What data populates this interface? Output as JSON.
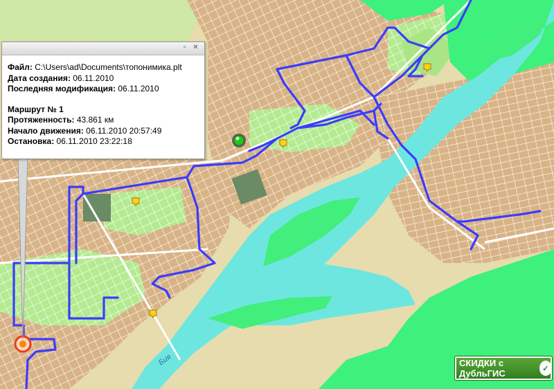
{
  "popup": {
    "file_label": "Файл:",
    "file_value": "C:\\Users\\ad\\Documents\\топонимика.plt",
    "created_label": "Дата создания:",
    "created_value": "06.11.2010",
    "modified_label": "Последняя модификация:",
    "modified_value": "06.11.2010",
    "route_label": "Маршрут № 1",
    "length_label": "Протяженность:",
    "length_value": "43.861 км",
    "start_label": "Начало движения:",
    "start_value": "06.11.2010 20:57:49",
    "stop_label": "Остановка:",
    "stop_value": "06.11.2010 23:22:18",
    "minimize_icon": "minimize-icon",
    "close_icon": "close-icon"
  },
  "map": {
    "river_label": "Бия",
    "promo_text": "СКИДКИ с ДубльГИС",
    "colors": {
      "land": "#e8dcb0",
      "urban": "#d9b489",
      "parks": "#b6eb91",
      "water": "#6fe7e2",
      "islands": "#43ef7e",
      "route": "#3a3cff",
      "roads": "#ffffff"
    },
    "markers": [
      "start-marker-green",
      "end-marker-red",
      "poi-marker-yellow"
    ]
  }
}
